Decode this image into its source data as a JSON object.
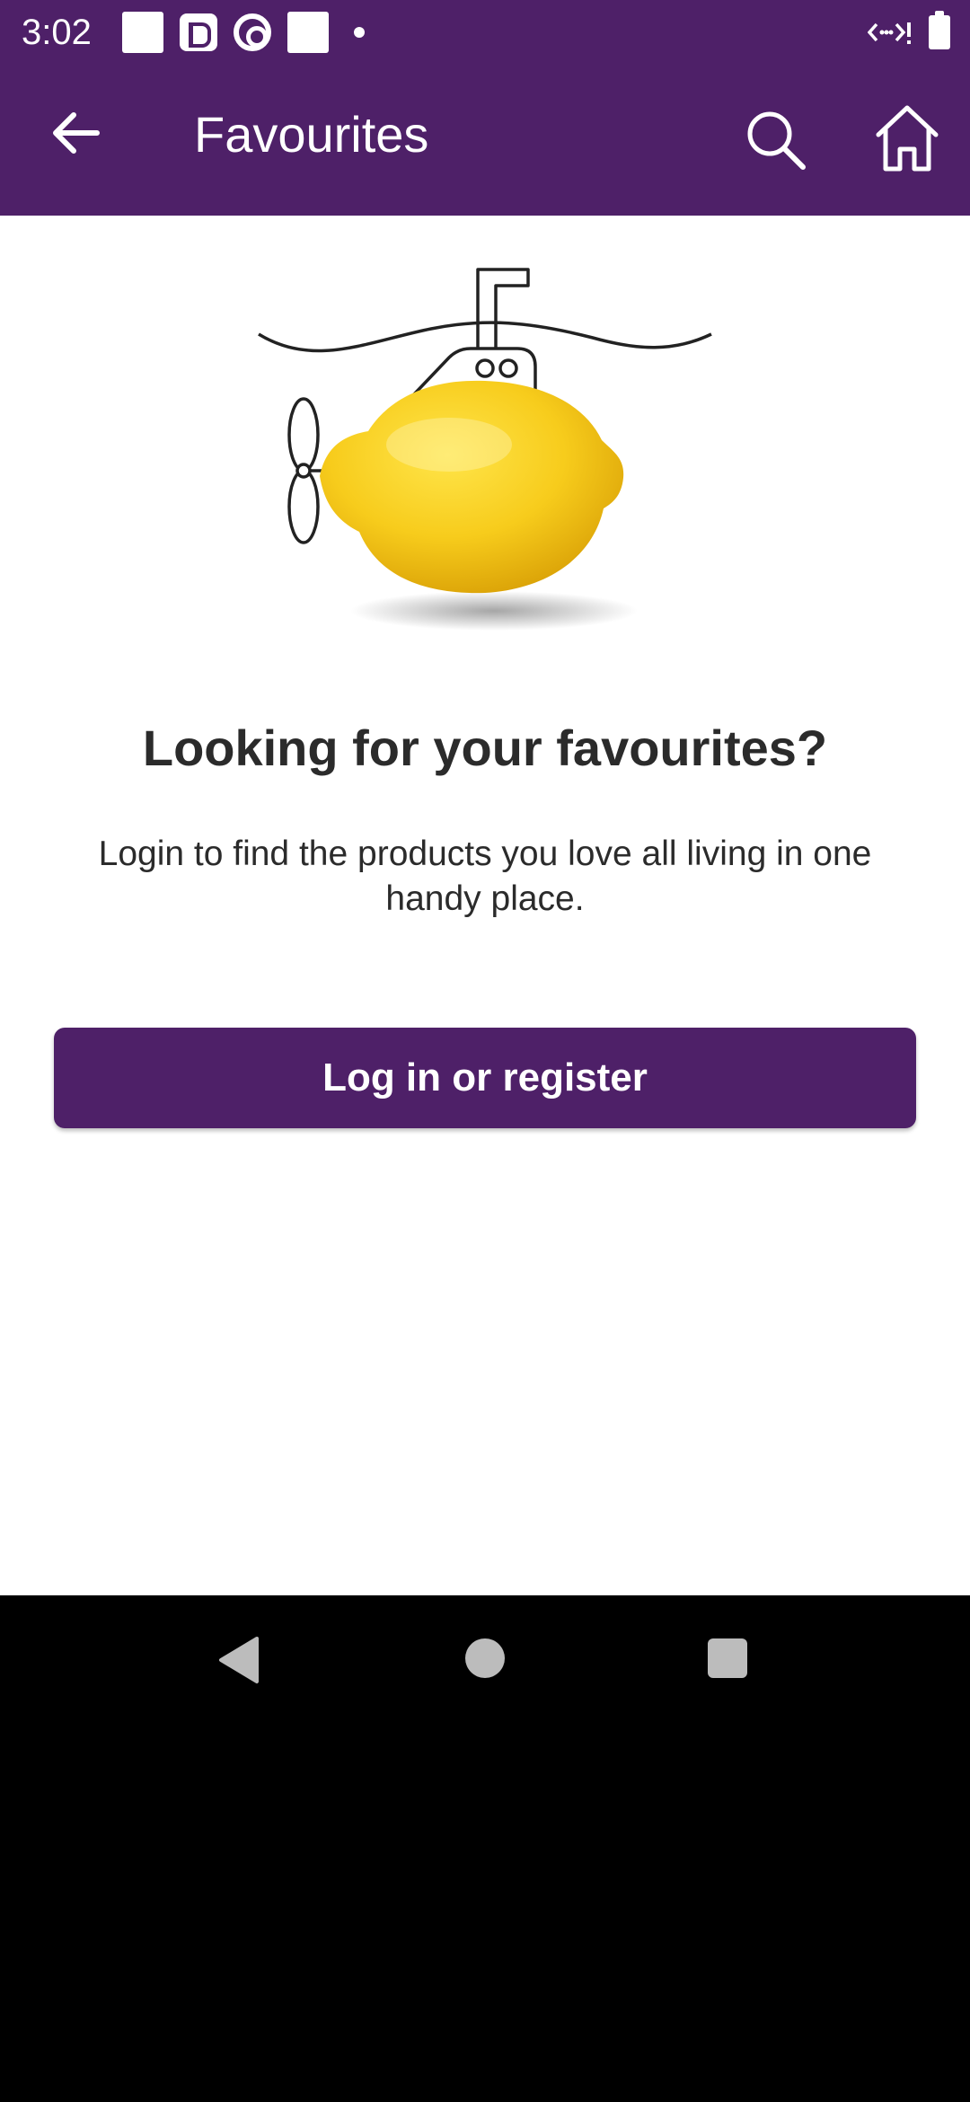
{
  "status_bar": {
    "time": "3:02",
    "left_icons": [
      "notification-square-icon",
      "app-d-icon",
      "target-icon",
      "notification-square-icon",
      "dot-icon"
    ],
    "right_icons": [
      "data-signal-icon",
      "battery-icon"
    ]
  },
  "app_bar": {
    "title": "Favourites",
    "background": "#4e2068",
    "back_icon": "arrow-left-icon",
    "search_icon": "search-icon",
    "home_icon": "home-icon"
  },
  "empty_state": {
    "illustration": "lemon-submarine-illustration",
    "heading": "Looking for your favourites?",
    "body": "Login to find the products you love all living in one handy place."
  },
  "cta": {
    "label": "Log in or register",
    "color": "#4e2068"
  },
  "system_nav": {
    "items": [
      "back-triangle-icon",
      "home-circle-icon",
      "recents-square-icon"
    ]
  }
}
